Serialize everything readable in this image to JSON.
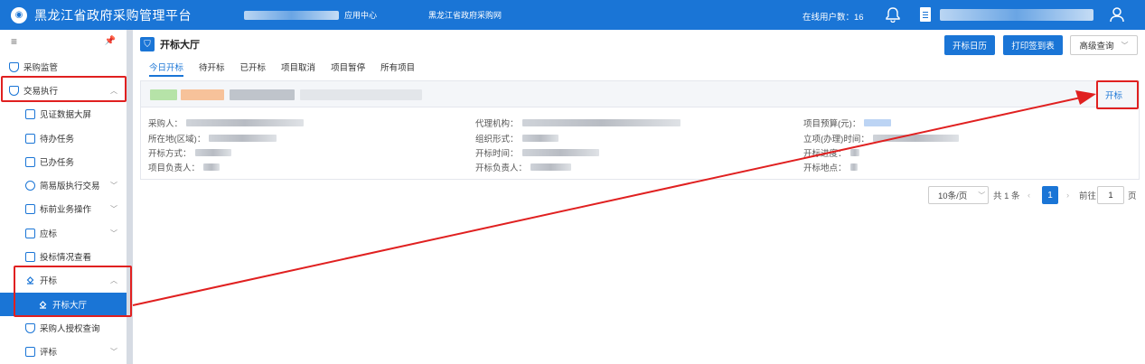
{
  "header": {
    "title": "黑龙江省政府采购管理平台",
    "app_center": "应用中心",
    "gov_site": "黑龙江省政府采购网",
    "online_users": "在线用户数：16"
  },
  "sidebar": {
    "items": [
      {
        "label": "采购监管",
        "icon": "shield-icon"
      },
      {
        "label": "交易执行",
        "icon": "shield-check-icon"
      },
      {
        "label": "见证数据大屏",
        "icon": "dashboard-icon"
      },
      {
        "label": "待办任务",
        "icon": "task-icon"
      },
      {
        "label": "已办任务",
        "icon": "task-done-icon"
      },
      {
        "label": "简易版执行交易",
        "icon": "link-icon"
      },
      {
        "label": "标前业务操作",
        "icon": "cart-icon"
      },
      {
        "label": "应标",
        "icon": "bid-icon"
      },
      {
        "label": "投标情况查看",
        "icon": "view-icon"
      },
      {
        "label": "开标",
        "icon": "gavel-icon"
      },
      {
        "label": "开标大厅",
        "icon": "gavel-icon"
      },
      {
        "label": "采购人授权查询",
        "icon": "shield-search-icon"
      },
      {
        "label": "评标",
        "icon": "evaluate-icon"
      }
    ]
  },
  "page": {
    "title": "开标大厅",
    "buttons": {
      "calendar": "开标日历",
      "print": "打印签到表",
      "advanced": "高级查询"
    },
    "tabs": [
      "今日开标",
      "待开标",
      "已开标",
      "项目取消",
      "项目暂停",
      "所有项目"
    ],
    "card": {
      "open_button": "开标",
      "fields": [
        {
          "label": "采购人："
        },
        {
          "label": "代理机构："
        },
        {
          "label": "项目预算(元)："
        },
        {
          "label": "所在地(区域)："
        },
        {
          "label": "组织形式："
        },
        {
          "label": "立项(办理)时间："
        },
        {
          "label": "开标方式："
        },
        {
          "label": "开标时间："
        },
        {
          "label": "开标进度："
        },
        {
          "label": "项目负责人："
        },
        {
          "label": "开标负责人："
        },
        {
          "label": "开标地点："
        }
      ]
    },
    "pagination": {
      "page_size": "10条/页",
      "total": "共 1 条",
      "current": "1",
      "goto_label": "前往",
      "goto_value": "1",
      "page_suffix": "页"
    }
  },
  "colors": {
    "primary": "#1a75d6",
    "annotation": "#e02020"
  }
}
